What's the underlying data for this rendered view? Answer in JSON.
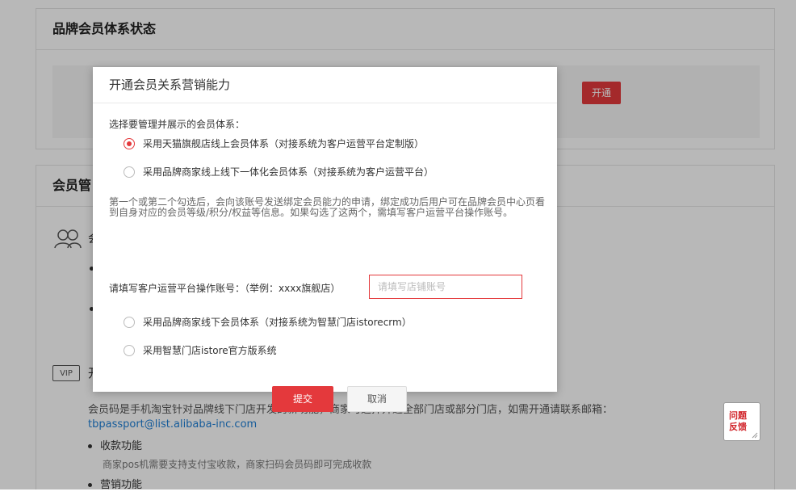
{
  "status_card": {
    "title": "品牌会员体系状态",
    "open_button": "开通"
  },
  "manage_card": {
    "title": "会员管",
    "members_title": "会",
    "vip_badge": "VIP",
    "vip_title": "开",
    "description": "会员码是手机淘宝针对品牌线下门店开发的新功能，商家可选择开通全部门店或部分门店，如需开通请联系邮箱：",
    "email": "tbpassport@list.alibaba-inc.com",
    "features": [
      {
        "title": "收款功能",
        "desc": "商家pos机需要支持支付宝收款，商家扫码会员码即可完成收款"
      },
      {
        "title": "营销功能"
      }
    ]
  },
  "modal": {
    "title": "开通会员关系营销能力",
    "section_label": "选择要管理并展示的会员体系：",
    "options": [
      {
        "label": "采用天猫旗舰店线上会员体系（对接系统为客户运营平台定制版）",
        "checked": true
      },
      {
        "label": "采用品牌商家线上线下一体化会员体系（对接系统为客户运营平台）",
        "checked": false
      },
      {
        "label": "采用品牌商家线下会员体系（对接系统为智慧门店istorecrm）",
        "checked": false
      },
      {
        "label": "采用智慧门店istore官方版系统",
        "checked": false
      }
    ],
    "notice": "第一个或第二个勾选后，会向该账号发送绑定会员能力的申请，绑定成功后用户可在品牌会员中心页看到自身对应的会员等级/积分/权益等信息。如果勾选了这两个，需填写客户运营平台操作账号。",
    "account_label": "请填写客户运营平台操作账号：（举例：xxxx旗舰店）",
    "account_placeholder": "请填写店铺账号",
    "account_value": "",
    "submit_label": "提交",
    "cancel_label": "取消"
  },
  "feedback": {
    "line1": "问题",
    "line2": "反馈"
  },
  "colors": {
    "accent": "#e4393c",
    "link": "#1e7fd6"
  }
}
